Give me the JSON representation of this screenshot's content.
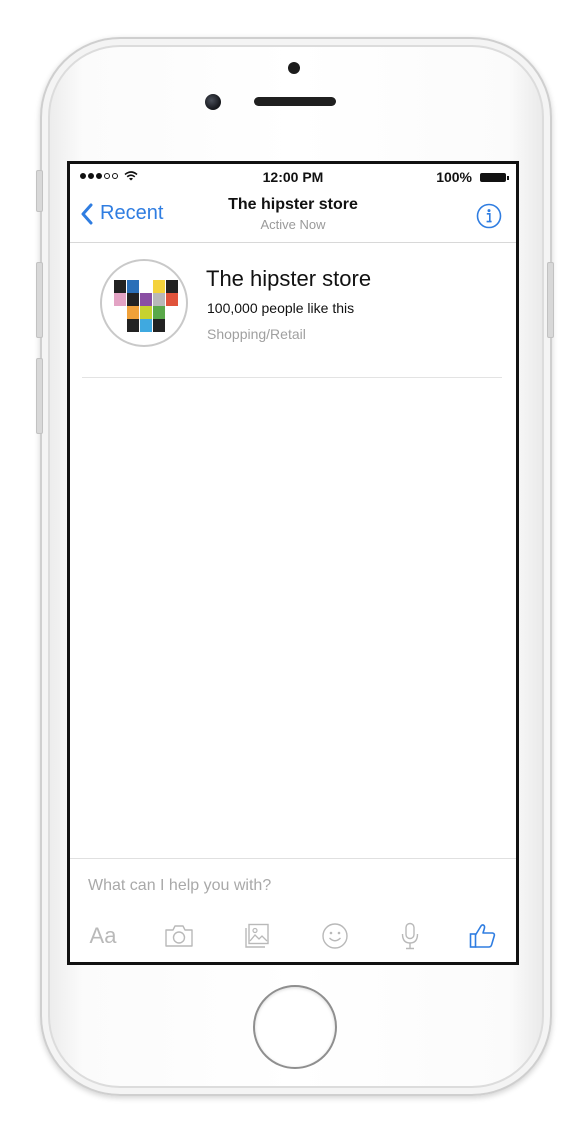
{
  "status_bar": {
    "time": "12:00 PM",
    "battery": "100%"
  },
  "nav": {
    "back_label": "Recent",
    "title": "The hipster store",
    "subtitle": "Active Now"
  },
  "page": {
    "name": "The hipster store",
    "likes": "100,000 people like this",
    "category": "Shopping/Retail"
  },
  "composer": {
    "placeholder": "What can I help you with?",
    "text_button_label": "Aa"
  },
  "icons": {
    "back": "chevron-left-icon",
    "info": "info-icon",
    "camera": "camera-icon",
    "gallery": "photo-gallery-icon",
    "emoji": "smiley-icon",
    "mic": "microphone-icon",
    "like": "thumbs-up-icon"
  },
  "colors": {
    "accent": "#2f7de1",
    "muted": "#a9a9a9",
    "toolbar_icon": "#b9b9b9"
  }
}
